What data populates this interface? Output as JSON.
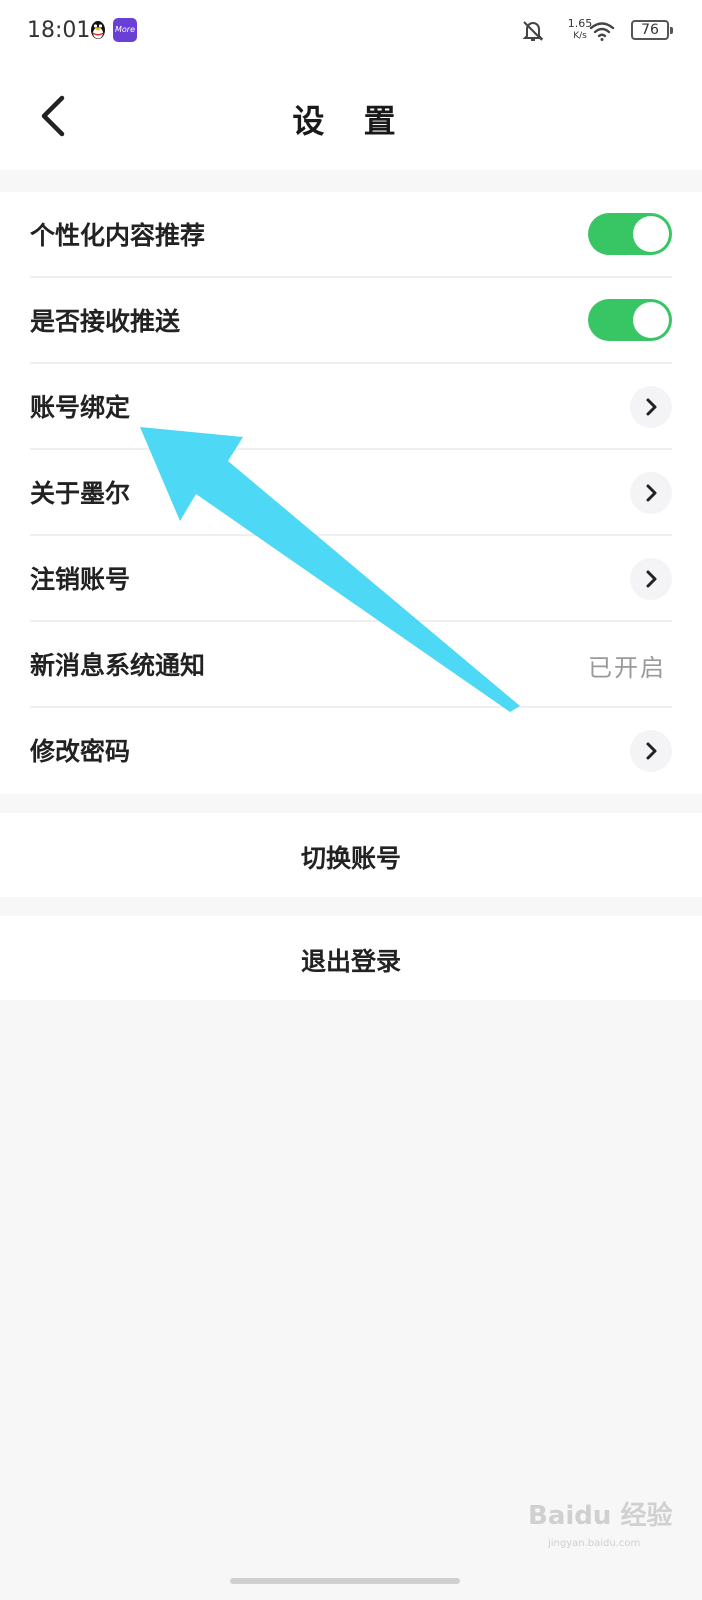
{
  "status_bar": {
    "time": "18:01",
    "net_speed_value": "1.65",
    "net_speed_unit": "K/s",
    "battery": "76",
    "icons": [
      "qq-icon",
      "mora-icon",
      "bell-muted-icon",
      "wifi-icon",
      "battery-icon"
    ]
  },
  "header": {
    "title": "设 置",
    "back_icon": "chevron-left-icon"
  },
  "settings": {
    "items": [
      {
        "label": "个性化内容推荐",
        "control": "toggle",
        "on": true
      },
      {
        "label": "是否接收推送",
        "control": "toggle",
        "on": true
      },
      {
        "label": "账号绑定",
        "control": "chevron"
      },
      {
        "label": "关于墨尔",
        "control": "chevron"
      },
      {
        "label": "注销账号",
        "control": "chevron"
      },
      {
        "label": "新消息系统通知",
        "control": "value",
        "value": "已开启"
      },
      {
        "label": "修改密码",
        "control": "chevron"
      }
    ]
  },
  "actions": {
    "switch_account": "切换账号",
    "logout": "退出登录"
  },
  "watermark": {
    "text": "Baidu 经验",
    "url_text": "jingyan.baidu.com"
  },
  "colors": {
    "toggle_on": "#38c664",
    "annotation_arrow": "#4dd8f5"
  }
}
